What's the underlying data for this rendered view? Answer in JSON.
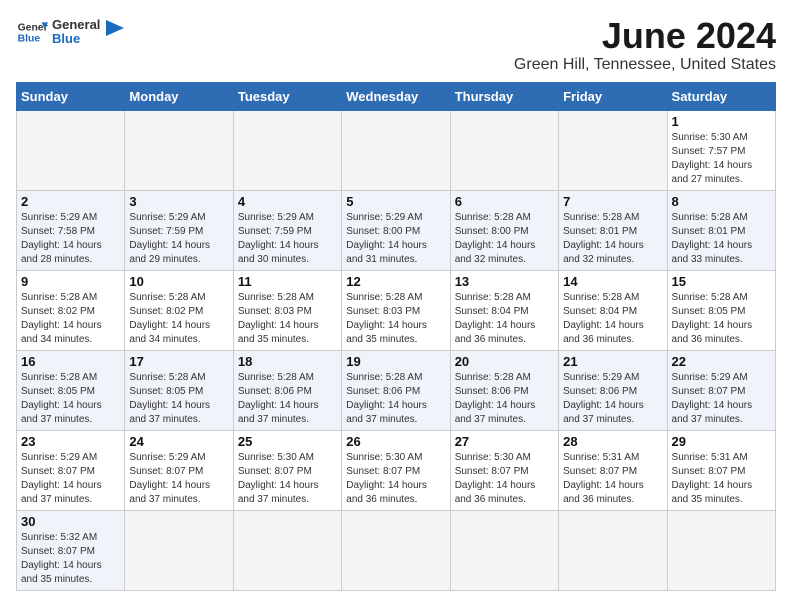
{
  "header": {
    "logo_general": "General",
    "logo_blue": "Blue",
    "month": "June 2024",
    "location": "Green Hill, Tennessee, United States"
  },
  "weekdays": [
    "Sunday",
    "Monday",
    "Tuesday",
    "Wednesday",
    "Thursday",
    "Friday",
    "Saturday"
  ],
  "days": {
    "d1": {
      "num": "1",
      "sunrise": "5:30 AM",
      "sunset": "7:57 PM",
      "daylight": "14 hours and 27 minutes."
    },
    "d2": {
      "num": "2",
      "sunrise": "5:29 AM",
      "sunset": "7:58 PM",
      "daylight": "14 hours and 28 minutes."
    },
    "d3": {
      "num": "3",
      "sunrise": "5:29 AM",
      "sunset": "7:59 PM",
      "daylight": "14 hours and 29 minutes."
    },
    "d4": {
      "num": "4",
      "sunrise": "5:29 AM",
      "sunset": "7:59 PM",
      "daylight": "14 hours and 30 minutes."
    },
    "d5": {
      "num": "5",
      "sunrise": "5:29 AM",
      "sunset": "8:00 PM",
      "daylight": "14 hours and 31 minutes."
    },
    "d6": {
      "num": "6",
      "sunrise": "5:28 AM",
      "sunset": "8:00 PM",
      "daylight": "14 hours and 32 minutes."
    },
    "d7": {
      "num": "7",
      "sunrise": "5:28 AM",
      "sunset": "8:01 PM",
      "daylight": "14 hours and 32 minutes."
    },
    "d8": {
      "num": "8",
      "sunrise": "5:28 AM",
      "sunset": "8:01 PM",
      "daylight": "14 hours and 33 minutes."
    },
    "d9": {
      "num": "9",
      "sunrise": "5:28 AM",
      "sunset": "8:02 PM",
      "daylight": "14 hours and 34 minutes."
    },
    "d10": {
      "num": "10",
      "sunrise": "5:28 AM",
      "sunset": "8:02 PM",
      "daylight": "14 hours and 34 minutes."
    },
    "d11": {
      "num": "11",
      "sunrise": "5:28 AM",
      "sunset": "8:03 PM",
      "daylight": "14 hours and 35 minutes."
    },
    "d12": {
      "num": "12",
      "sunrise": "5:28 AM",
      "sunset": "8:03 PM",
      "daylight": "14 hours and 35 minutes."
    },
    "d13": {
      "num": "13",
      "sunrise": "5:28 AM",
      "sunset": "8:04 PM",
      "daylight": "14 hours and 36 minutes."
    },
    "d14": {
      "num": "14",
      "sunrise": "5:28 AM",
      "sunset": "8:04 PM",
      "daylight": "14 hours and 36 minutes."
    },
    "d15": {
      "num": "15",
      "sunrise": "5:28 AM",
      "sunset": "8:05 PM",
      "daylight": "14 hours and 36 minutes."
    },
    "d16": {
      "num": "16",
      "sunrise": "5:28 AM",
      "sunset": "8:05 PM",
      "daylight": "14 hours and 37 minutes."
    },
    "d17": {
      "num": "17",
      "sunrise": "5:28 AM",
      "sunset": "8:05 PM",
      "daylight": "14 hours and 37 minutes."
    },
    "d18": {
      "num": "18",
      "sunrise": "5:28 AM",
      "sunset": "8:06 PM",
      "daylight": "14 hours and 37 minutes."
    },
    "d19": {
      "num": "19",
      "sunrise": "5:28 AM",
      "sunset": "8:06 PM",
      "daylight": "14 hours and 37 minutes."
    },
    "d20": {
      "num": "20",
      "sunrise": "5:28 AM",
      "sunset": "8:06 PM",
      "daylight": "14 hours and 37 minutes."
    },
    "d21": {
      "num": "21",
      "sunrise": "5:29 AM",
      "sunset": "8:06 PM",
      "daylight": "14 hours and 37 minutes."
    },
    "d22": {
      "num": "22",
      "sunrise": "5:29 AM",
      "sunset": "8:07 PM",
      "daylight": "14 hours and 37 minutes."
    },
    "d23": {
      "num": "23",
      "sunrise": "5:29 AM",
      "sunset": "8:07 PM",
      "daylight": "14 hours and 37 minutes."
    },
    "d24": {
      "num": "24",
      "sunrise": "5:29 AM",
      "sunset": "8:07 PM",
      "daylight": "14 hours and 37 minutes."
    },
    "d25": {
      "num": "25",
      "sunrise": "5:30 AM",
      "sunset": "8:07 PM",
      "daylight": "14 hours and 37 minutes."
    },
    "d26": {
      "num": "26",
      "sunrise": "5:30 AM",
      "sunset": "8:07 PM",
      "daylight": "14 hours and 36 minutes."
    },
    "d27": {
      "num": "27",
      "sunrise": "5:30 AM",
      "sunset": "8:07 PM",
      "daylight": "14 hours and 36 minutes."
    },
    "d28": {
      "num": "28",
      "sunrise": "5:31 AM",
      "sunset": "8:07 PM",
      "daylight": "14 hours and 36 minutes."
    },
    "d29": {
      "num": "29",
      "sunrise": "5:31 AM",
      "sunset": "8:07 PM",
      "daylight": "14 hours and 35 minutes."
    },
    "d30": {
      "num": "30",
      "sunrise": "5:32 AM",
      "sunset": "8:07 PM",
      "daylight": "14 hours and 35 minutes."
    }
  }
}
